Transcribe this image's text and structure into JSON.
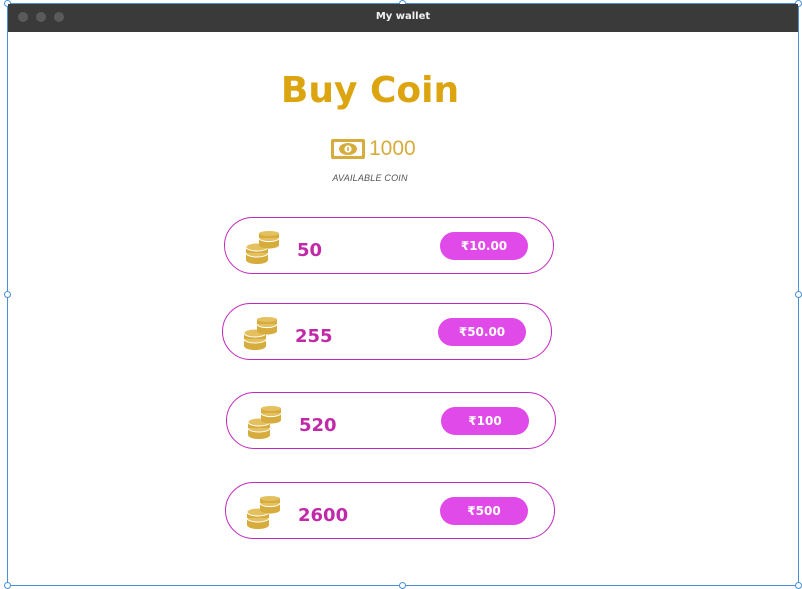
{
  "window": {
    "title": "My wallet"
  },
  "page": {
    "heading": "Buy Coin"
  },
  "balance": {
    "value": "1000",
    "label": "AVAILABLE COIN",
    "icon": "money-icon"
  },
  "packages": [
    {
      "coins": "50",
      "price": "₹10.00",
      "icon": "coins-icon"
    },
    {
      "coins": "255",
      "price": "₹50.00",
      "icon": "coins-icon"
    },
    {
      "coins": "520",
      "price": "₹100",
      "icon": "coins-icon"
    },
    {
      "coins": "2600",
      "price": "₹500",
      "icon": "coins-icon"
    }
  ],
  "colors": {
    "heading": "#dca40e",
    "coin_gold": "#d6ac3c",
    "accent_magenta": "#c228c0",
    "button": "#e04ae8",
    "titlebar": "#3a3a3a"
  }
}
